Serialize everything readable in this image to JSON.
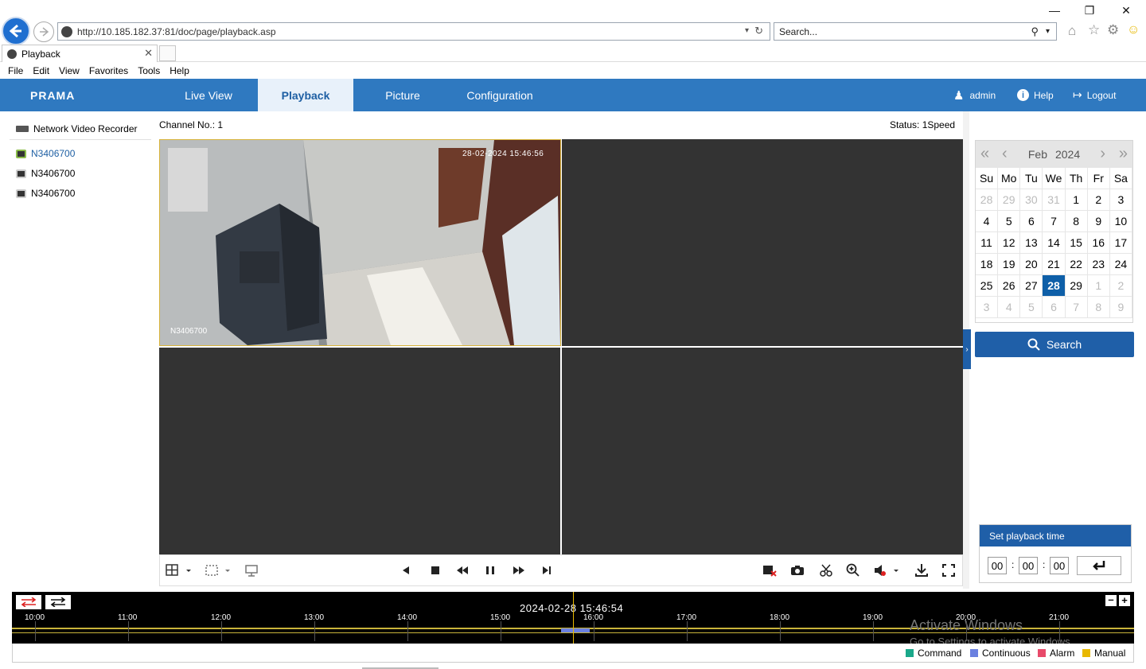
{
  "browser": {
    "url": "http://10.185.182.37:81/doc/page/playback.asp",
    "search_placeholder": "Search...",
    "tab_title": "Playback",
    "menu": [
      "File",
      "Edit",
      "View",
      "Favorites",
      "Tools",
      "Help"
    ]
  },
  "app": {
    "logo": "PRAMA",
    "nav_tabs": [
      {
        "label": "Live View",
        "active": false
      },
      {
        "label": "Playback",
        "active": true
      },
      {
        "label": "Picture",
        "active": false
      },
      {
        "label": "Configuration",
        "active": false
      }
    ],
    "user": "admin",
    "help": "Help",
    "logout": "Logout"
  },
  "tree": {
    "root": "Network Video Recorder",
    "cameras": [
      "N3406700",
      "N3406700",
      "N3406700"
    ]
  },
  "playback": {
    "channel": "Channel No.: 1",
    "status": "Status: 1Speed",
    "osd_time": "28-02-2024 15:46:56",
    "osd_name": "N3406700"
  },
  "calendar": {
    "month": "Feb",
    "year": "2024",
    "weekdays": [
      "Su",
      "Mo",
      "Tu",
      "We",
      "Th",
      "Fr",
      "Sa"
    ],
    "days": [
      [
        "28",
        "29",
        "30",
        "31",
        "1",
        "2",
        "3"
      ],
      [
        "4",
        "5",
        "6",
        "7",
        "8",
        "9",
        "10"
      ],
      [
        "11",
        "12",
        "13",
        "14",
        "15",
        "16",
        "17"
      ],
      [
        "18",
        "19",
        "20",
        "21",
        "22",
        "23",
        "24"
      ],
      [
        "25",
        "26",
        "27",
        "28",
        "29",
        "1",
        "2"
      ],
      [
        "3",
        "4",
        "5",
        "6",
        "7",
        "8",
        "9"
      ]
    ],
    "selected_day": "28",
    "search_label": "Search"
  },
  "playback_time": {
    "title": "Set playback time",
    "hh": "00",
    "mm": "00",
    "ss": "00"
  },
  "timeline": {
    "current": "2024-02-28 15:46:54",
    "hours": [
      "10:00",
      "11:00",
      "12:00",
      "13:00",
      "14:00",
      "15:00",
      "16:00",
      "17:00",
      "18:00",
      "19:00",
      "20:00",
      "21:00"
    ]
  },
  "legend": [
    {
      "label": "Command",
      "color": "#1aa88a"
    },
    {
      "label": "Continuous",
      "color": "#6a80e0"
    },
    {
      "label": "Alarm",
      "color": "#e84a6a"
    },
    {
      "label": "Manual",
      "color": "#e8b800"
    }
  ],
  "watermark": {
    "line1": "Activate Windows",
    "line2": "Go to Settings to activate Windows."
  }
}
